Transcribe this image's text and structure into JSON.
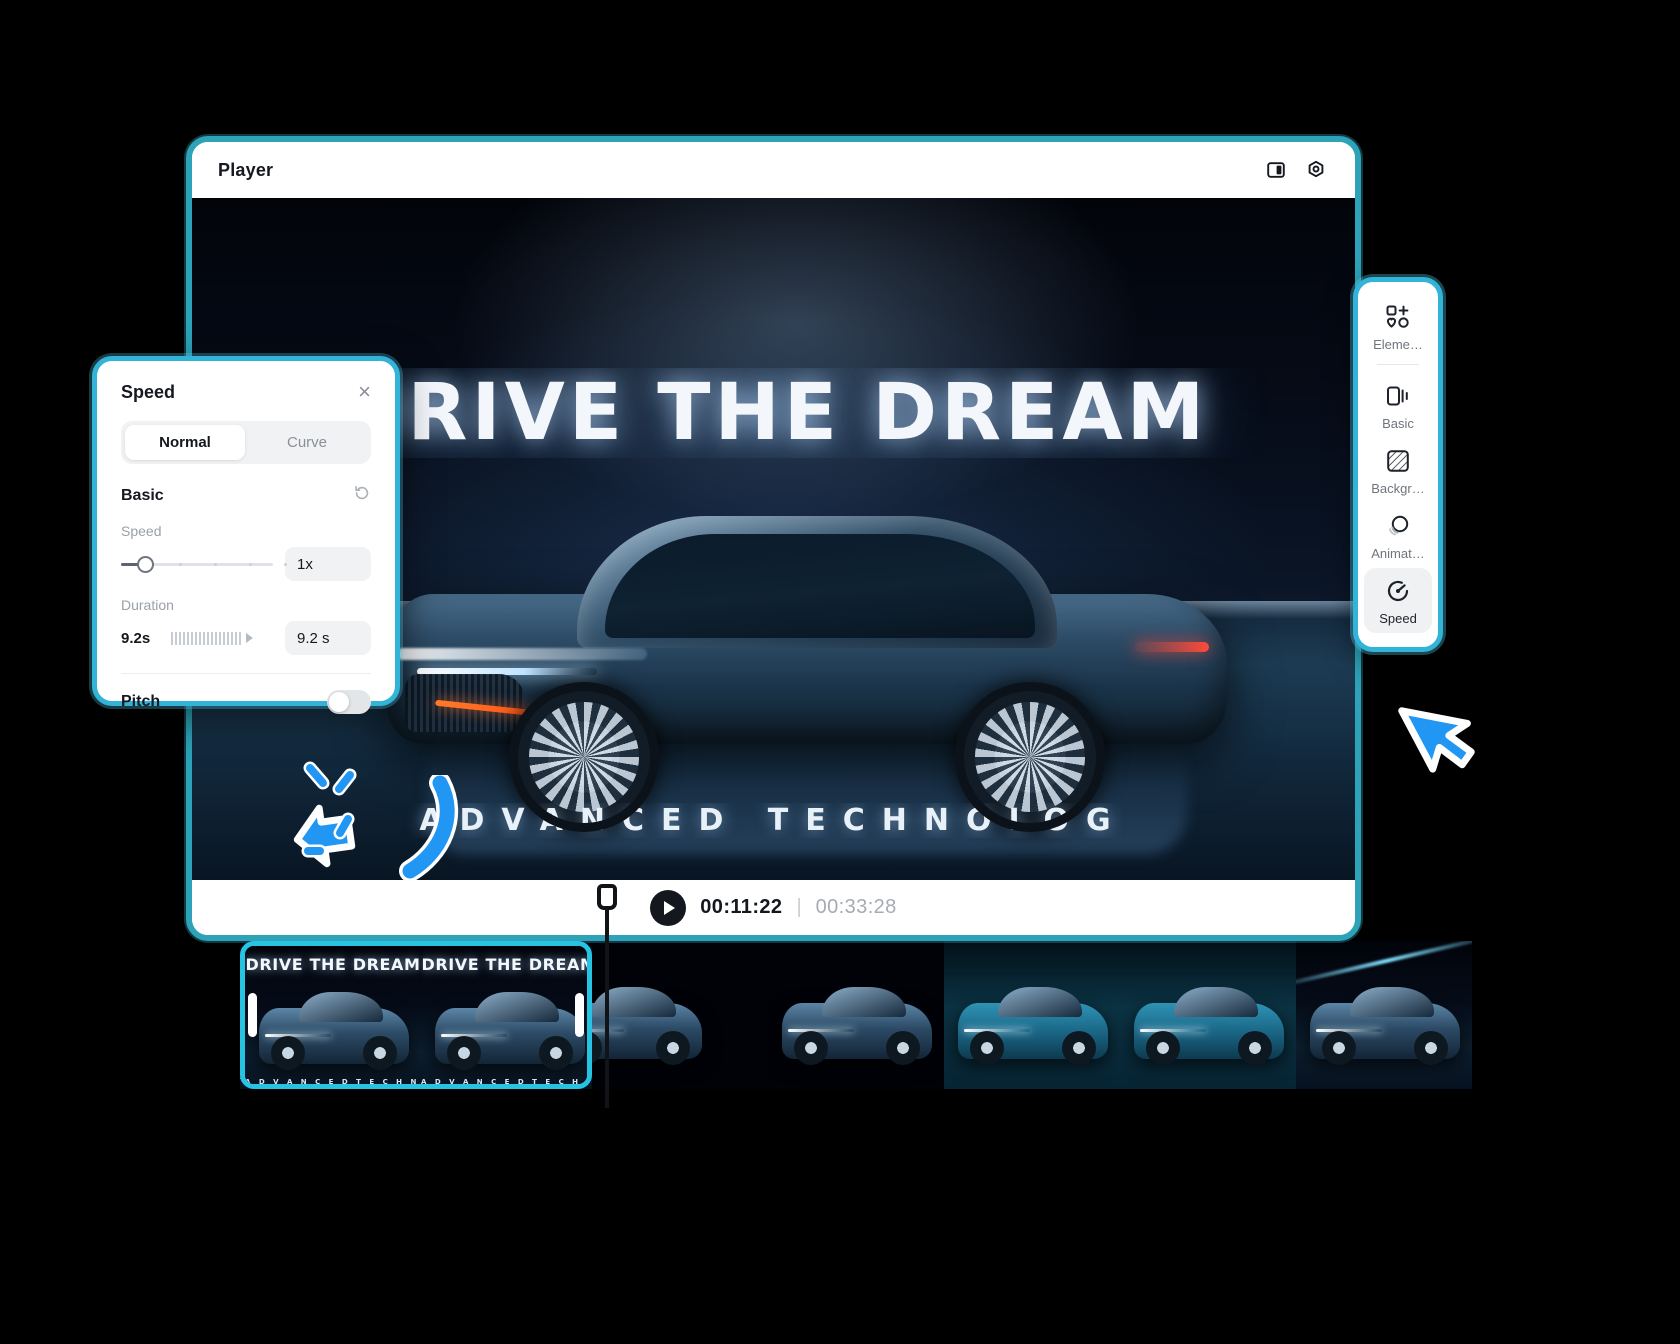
{
  "window": {
    "title": "Player",
    "icons": [
      {
        "name": "split-panel-icon",
        "glyph": "split"
      },
      {
        "name": "settings-gear-icon",
        "glyph": "gear"
      }
    ]
  },
  "video": {
    "headline": "DRIVE THE DREAM",
    "subline": "ADVANCED TECHNOLOG"
  },
  "playback": {
    "play_label": "play",
    "current_time": "00:11:22",
    "separator": "|",
    "total_time": "00:33:28"
  },
  "sidebar": {
    "items": [
      {
        "label": "Eleme…",
        "icon": "elements-icon",
        "active": false
      },
      {
        "label": "Basic",
        "icon": "basic-icon",
        "active": false
      },
      {
        "label": "Backgr…",
        "icon": "background-icon",
        "active": false
      },
      {
        "label": "Animat…",
        "icon": "animation-icon",
        "active": false
      },
      {
        "label": "Speed",
        "icon": "speed-gauge-icon",
        "active": true
      }
    ]
  },
  "speed_panel": {
    "title": "Speed",
    "close_label": "×",
    "tabs": [
      {
        "label": "Normal",
        "selected": true
      },
      {
        "label": "Curve",
        "selected": false
      }
    ],
    "section_title": "Basic",
    "reset_icon": "reset-icon",
    "speed": {
      "label": "Speed",
      "value": "1x",
      "slider_percent": 12
    },
    "duration": {
      "label": "Duration",
      "left_value": "9.2s",
      "value": "9.2 s"
    },
    "pitch": {
      "label": "Pitch",
      "enabled": false
    }
  },
  "timeline": {
    "selected_clip": {
      "thumb_title": "DRIVE THE DREAM",
      "thumb_subtitle": "A D V A N C E D   T E C H N O L O G"
    },
    "clips": [
      {
        "style": "dark",
        "title": "",
        "subtitle": ""
      },
      {
        "style": "dark",
        "title": "",
        "subtitle": ""
      },
      {
        "style": "teal",
        "title": "",
        "subtitle": ""
      },
      {
        "style": "teal",
        "title": "",
        "subtitle": ""
      },
      {
        "style": "streak",
        "title": "",
        "subtitle": ""
      },
      {
        "style": "streak",
        "title": "",
        "subtitle": ""
      }
    ]
  },
  "colors": {
    "accent": "#27c3e3",
    "panel_border": "#33b3d8",
    "window_border": "#2da2b8",
    "arrow": "#2196f3",
    "text_dark": "#15181f",
    "text_muted": "#9aa0a7"
  }
}
